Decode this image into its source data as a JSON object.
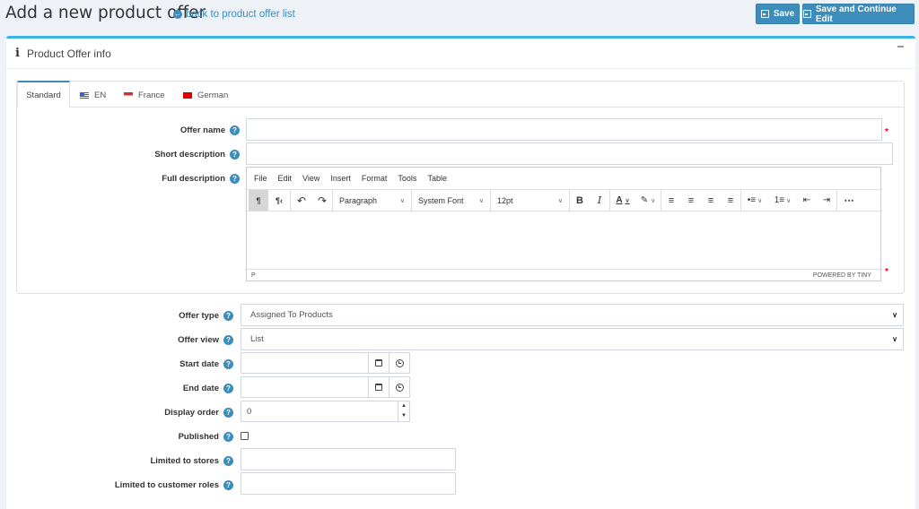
{
  "header": {
    "title": "Add a new product offer",
    "back_link": "back to product offer list",
    "save_label": "Save",
    "save_continue_label": "Save and Continue Edit"
  },
  "card": {
    "title": "Product Offer info"
  },
  "tabs": [
    {
      "label": "Standard",
      "flag": null,
      "active": true
    },
    {
      "label": "EN",
      "flag": "us"
    },
    {
      "label": "France",
      "flag": "fr"
    },
    {
      "label": "German",
      "flag": "de"
    }
  ],
  "fields": {
    "offer_name": {
      "label": "Offer name",
      "value": ""
    },
    "short_description": {
      "label": "Short description",
      "value": ""
    },
    "full_description": {
      "label": "Full description"
    },
    "offer_type": {
      "label": "Offer type",
      "value": "Assigned To Products"
    },
    "offer_view": {
      "label": "Offer view",
      "value": "List"
    },
    "start_date": {
      "label": "Start date",
      "value": ""
    },
    "end_date": {
      "label": "End date",
      "value": ""
    },
    "display_order": {
      "label": "Display order",
      "value": "0"
    },
    "published": {
      "label": "Published",
      "checked": false
    },
    "limited_to_stores": {
      "label": "Limited to stores"
    },
    "limited_to_customer_roles": {
      "label": "Limited to customer roles"
    }
  },
  "editor": {
    "menu": [
      "File",
      "Edit",
      "View",
      "Insert",
      "Format",
      "Tools",
      "Table"
    ],
    "block_format": "Paragraph",
    "font_family": "System Font",
    "font_size": "12pt",
    "path": "P",
    "powered_by": "POWERED BY TINY"
  },
  "colors": {
    "accent": "#3c8dbc",
    "card_border": "#3bb4e8",
    "required": "#ee0033"
  }
}
